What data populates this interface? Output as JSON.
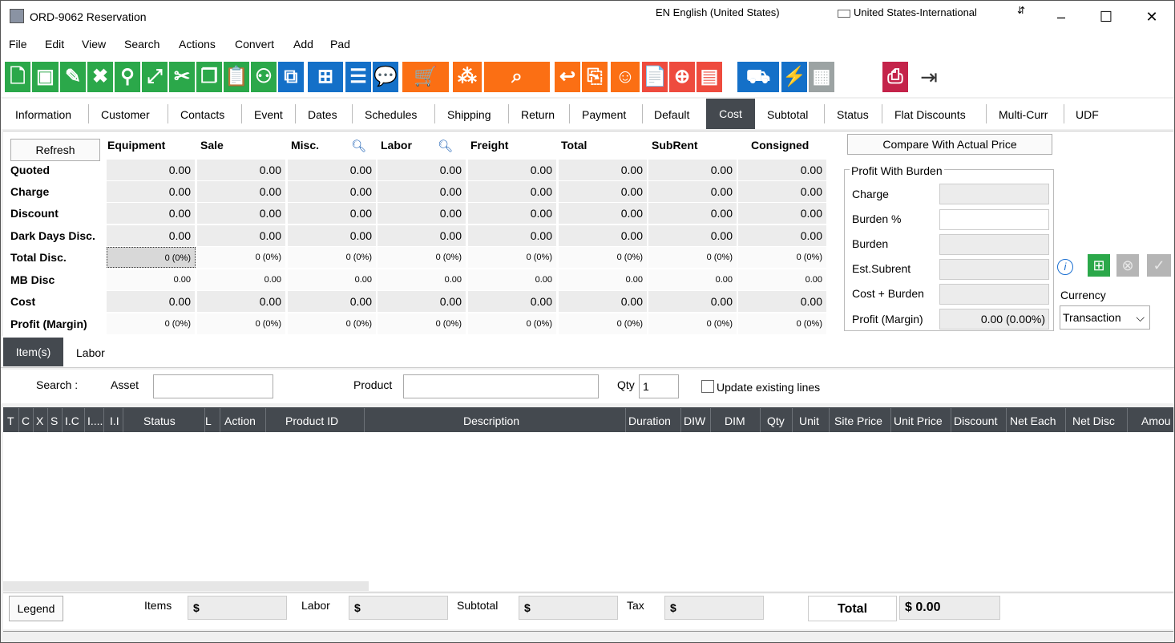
{
  "window": {
    "title": "ORD-9062 Reservation",
    "lang": "EN English (United States)",
    "keyboard": "United States-International",
    "ime_arrow": "⇵"
  },
  "menu": [
    "File",
    "Edit",
    "View",
    "Search",
    "Actions",
    "Convert",
    "Add",
    "Pad"
  ],
  "toolbar_icons": [
    "new-document-icon",
    "save-icon",
    "edit-icon",
    "delete-icon",
    "search-icon",
    "expand-icon",
    "cut-icon",
    "copy-icon",
    "paste-icon",
    "hierarchy-icon",
    "duplicate-icon",
    "layout-icon",
    "message-icon",
    "comment-icon",
    "purchase-order-icon",
    "network-icon",
    "search-package-icon",
    "return-icon",
    "receive-icon",
    "smiley-icon",
    "document-list-icon",
    "add-invoice-icon",
    "money-icon",
    "truck-icon",
    "lightning-icon",
    "calendar-icon",
    "printer-icon",
    "exit-icon"
  ],
  "tabs": [
    "Information",
    "Customer",
    "Contacts",
    "Event",
    "Dates",
    "Schedules",
    "Shipping",
    "Return",
    "Payment",
    "Default",
    "Cost",
    "Subtotal",
    "Status",
    "Flat Discounts",
    "Multi-Curr",
    "UDF"
  ],
  "cost": {
    "refresh_label": "Refresh",
    "columns": [
      "Equipment",
      "Sale",
      "Misc.",
      "Labor",
      "Freight",
      "Total",
      "SubRent",
      "Consigned"
    ],
    "rows": [
      {
        "label": "Quoted",
        "values": [
          "0.00",
          "0.00",
          "0.00",
          "0.00",
          "0.00",
          "0.00",
          "0.00",
          "0.00"
        ]
      },
      {
        "label": "Charge",
        "values": [
          "0.00",
          "0.00",
          "0.00",
          "0.00",
          "0.00",
          "0.00",
          "0.00",
          "0.00"
        ]
      },
      {
        "label": "Discount",
        "values": [
          "0.00",
          "0.00",
          "0.00",
          "0.00",
          "0.00",
          "0.00",
          "0.00",
          "0.00"
        ]
      },
      {
        "label": "Dark Days Disc.",
        "values": [
          "0.00",
          "0.00",
          "0.00",
          "0.00",
          "0.00",
          "0.00",
          "0.00",
          "0.00"
        ]
      },
      {
        "label": "Total Disc.",
        "values": [
          "0 (0%)",
          "0 (0%)",
          "0 (0%)",
          "0 (0%)",
          "0 (0%)",
          "0 (0%)",
          "0 (0%)",
          "0 (0%)"
        ]
      },
      {
        "label": "MB Disc",
        "values": [
          "0.00",
          "0.00",
          "0.00",
          "0.00",
          "0.00",
          "0.00",
          "0.00",
          "0.00"
        ]
      },
      {
        "label": "Cost",
        "values": [
          "0.00",
          "0.00",
          "0.00",
          "0.00",
          "0.00",
          "0.00",
          "0.00",
          "0.00"
        ]
      },
      {
        "label": "Profit (Margin)",
        "values": [
          "0 (0%)",
          "0 (0%)",
          "0 (0%)",
          "0 (0%)",
          "0 (0%)",
          "0 (0%)",
          "0 (0%)",
          "0 (0%)"
        ]
      }
    ]
  },
  "profit": {
    "compare_label": "Compare With Actual Price",
    "group_title": "Profit With Burden",
    "fields": [
      {
        "label": "Charge",
        "value": ""
      },
      {
        "label": "Burden %",
        "value": ""
      },
      {
        "label": "Burden",
        "value": ""
      },
      {
        "label": "Est.Subrent",
        "value": ""
      },
      {
        "label": "Cost + Burden",
        "value": ""
      },
      {
        "label": "Profit (Margin)",
        "value": "0.00 (0.00%)"
      }
    ],
    "currency_label": "Currency",
    "currency_value": "Transaction"
  },
  "items": {
    "tabs": [
      "Item(s)",
      "Labor"
    ],
    "search_label": "Search :",
    "asset_label": "Asset",
    "asset_value": "",
    "product_label": "Product",
    "product_value": "",
    "qty_label": "Qty",
    "qty_value": "1",
    "update_label": "Update existing lines",
    "columns": [
      "T",
      "C",
      "X",
      "S",
      "I.C",
      "I....",
      "I.I",
      "Status",
      "L",
      "Action",
      "Product ID",
      "Description",
      "Duration",
      "DIW",
      "DIM",
      "Qty",
      "Unit",
      "Site Price",
      "Unit Price",
      "Discount",
      "Net Each",
      "Net Disc",
      "Amou"
    ]
  },
  "footer": {
    "legend_label": "Legend",
    "items_label": "Items",
    "items_value": "$",
    "labor_label": "Labor",
    "labor_value": "$",
    "subtotal_label": "Subtotal",
    "subtotal_value": "$",
    "tax_label": "Tax",
    "tax_value": "$",
    "total_label": "Total",
    "total_value": "$ 0.00"
  }
}
